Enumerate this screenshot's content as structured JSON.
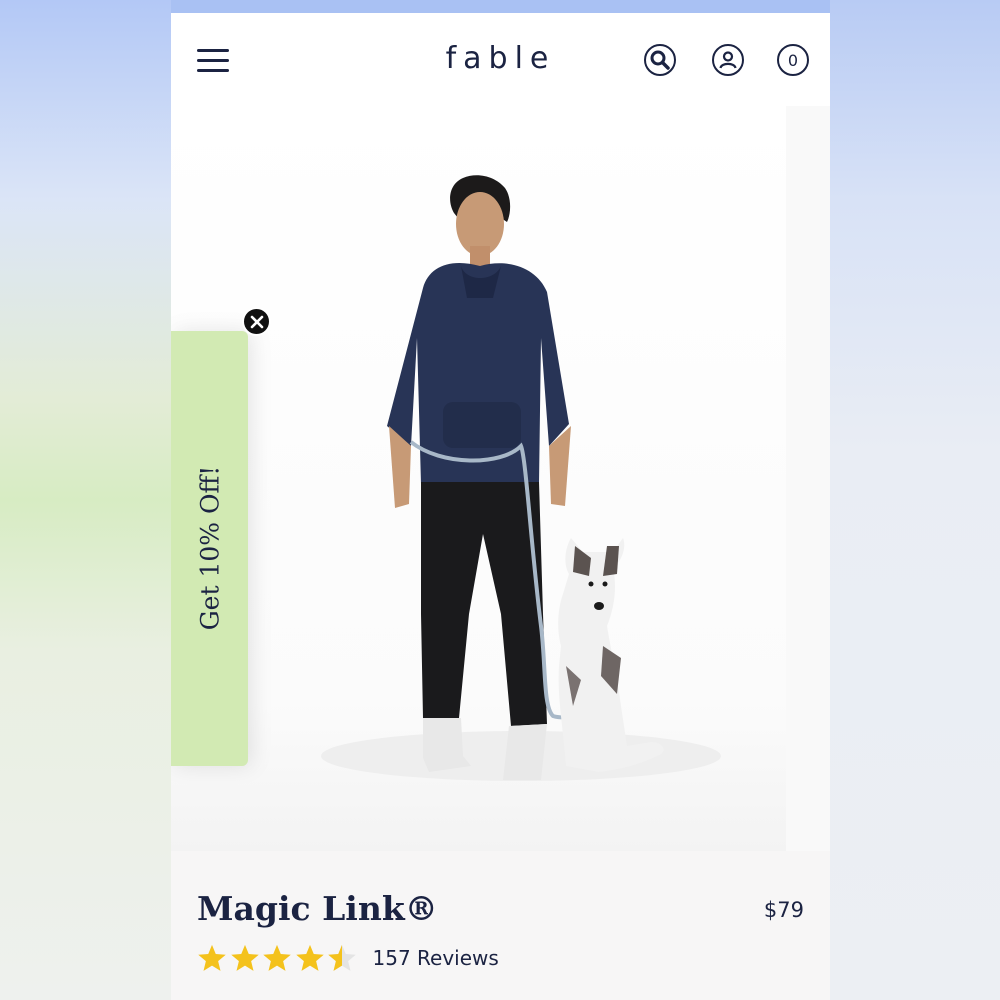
{
  "header": {
    "logo": "fable",
    "cart_count": "0",
    "icons": [
      "hamburger-menu-icon",
      "search-icon",
      "account-icon",
      "cart-icon"
    ]
  },
  "hero": {
    "image": "man-in-navy-hoodie-with-dog-on-magic-link-leash"
  },
  "promo": {
    "label": "Get 10% Off!",
    "close_icon": "close-icon"
  },
  "product": {
    "name": "Magic Link®",
    "price": "$79",
    "rating": 4.5,
    "rating_max": 5,
    "reviews_label": "157 Reviews"
  },
  "colors": {
    "brand_navy": "#1b2342",
    "promo_green": "#d2eab3",
    "star_gold": "#f4c21c"
  }
}
